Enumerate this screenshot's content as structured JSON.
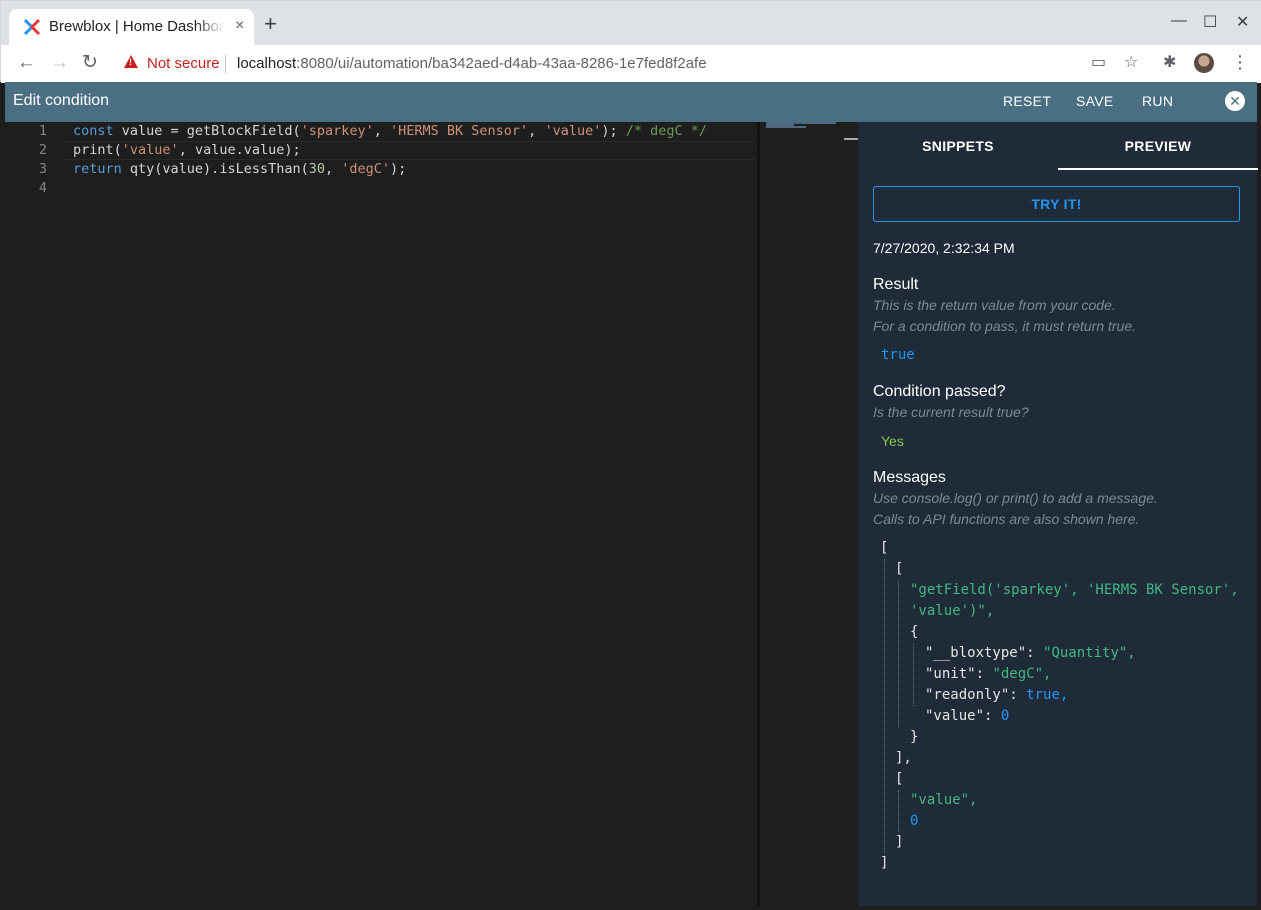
{
  "browser": {
    "tab_title": "Brewblox | Home Dashboard",
    "tab_close": "×",
    "new_tab": "+",
    "window_controls": {
      "minimize": "—",
      "maximize": "☐",
      "close": "✕"
    },
    "nav": {
      "back": "←",
      "forward": "→",
      "reload": "↻"
    },
    "security_label": "Not secure",
    "url_host": "localhost",
    "url_rest": ":8080/ui/automation/ba342aed-d4ab-43aa-8286-1e7fed8f2afe",
    "toolbar_icons": {
      "cast": "▭",
      "star": "☆",
      "extensions": "✱",
      "menu": "⋮"
    }
  },
  "appbar": {
    "title": "Edit condition",
    "reset_label": "RESET",
    "save_label": "SAVE",
    "run_label": "RUN",
    "close_icon": "✕",
    "color": "#4b6f82"
  },
  "editor": {
    "lines": [
      {
        "num": "1",
        "segments": [
          [
            "kw",
            "const"
          ],
          [
            "fn",
            " value = getBlockField("
          ],
          [
            "str",
            "'sparkey'"
          ],
          [
            "fn",
            ", "
          ],
          [
            "str",
            "'HERMS BK Sensor'"
          ],
          [
            "fn",
            ", "
          ],
          [
            "str",
            "'value'"
          ],
          [
            "fn",
            "); "
          ],
          [
            "cmt",
            "/* degC */"
          ]
        ]
      },
      {
        "num": "2",
        "segments": [
          [
            "fn",
            "print("
          ],
          [
            "str",
            "'value'"
          ],
          [
            "fn",
            ", value.value);"
          ]
        ]
      },
      {
        "num": "3",
        "segments": [
          [
            "kw",
            "return"
          ],
          [
            "fn",
            " qty(value).isLessThan("
          ],
          [
            "num",
            "30"
          ],
          [
            "fn",
            ", "
          ],
          [
            "str",
            "'degC'"
          ],
          [
            "fn",
            ");"
          ]
        ]
      },
      {
        "num": "4",
        "segments": []
      }
    ]
  },
  "panel": {
    "tabs": {
      "snippets": "SNIPPETS",
      "preview": "PREVIEW",
      "active": "preview"
    },
    "try_it_label": "TRY IT!",
    "timestamp": "7/27/2020, 2:32:34 PM",
    "result": {
      "heading": "Result",
      "hint1": "This is the return value from your code.",
      "hint2": "For a condition to pass, it must return true.",
      "value": "true"
    },
    "condition": {
      "heading": "Condition passed?",
      "hint": "Is the current result true?",
      "value": "Yes"
    },
    "messages": {
      "heading": "Messages",
      "hint1": "Use console.log() or print() to add a message.",
      "hint2": "Calls to API functions are also shown here.",
      "lines": [
        [
          [
            "jkey",
            "["
          ]
        ],
        [
          [
            "jkey",
            "["
          ]
        ],
        [
          [
            "jstr",
            "\"getField('sparkey', 'HERMS BK Sensor',"
          ]
        ],
        [
          [
            "jstr",
            "'value')\","
          ]
        ],
        [
          [
            "jkey",
            "{"
          ]
        ],
        [
          [
            "jkey",
            "\"__bloxtype\": "
          ],
          [
            "jstr",
            "\"Quantity\","
          ]
        ],
        [
          [
            "jkey",
            "\"unit\": "
          ],
          [
            "jstr",
            "\"degC\","
          ]
        ],
        [
          [
            "jkey",
            "\"readonly\": "
          ],
          [
            "jbool",
            "true,"
          ]
        ],
        [
          [
            "jkey",
            "\"value\": "
          ],
          [
            "jnum",
            "0"
          ]
        ],
        [
          [
            "jkey",
            "}"
          ]
        ],
        [
          [
            "jkey",
            "],"
          ]
        ],
        [
          [
            "jkey",
            "["
          ]
        ],
        [
          [
            "jstr",
            "\"value\","
          ]
        ],
        [
          [
            "jnum",
            "0"
          ]
        ],
        [
          [
            "jkey",
            "]"
          ]
        ],
        [
          [
            "jkey",
            "]"
          ]
        ]
      ]
    },
    "colors": {
      "accent": "#2196f3",
      "success": "#8bc34a",
      "string": "#41b883",
      "background": "#1f2b38"
    }
  }
}
